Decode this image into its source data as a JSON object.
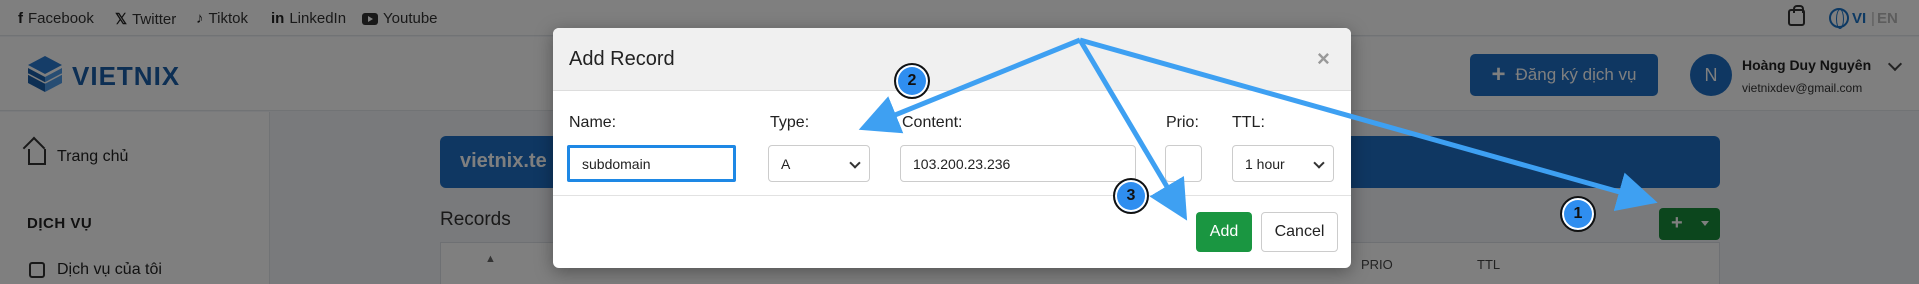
{
  "topbar": {
    "social": [
      {
        "icon": "facebook-icon",
        "glyph": "f",
        "label": "Facebook"
      },
      {
        "icon": "twitter-icon",
        "glyph": "𝕏",
        "label": "Twitter"
      },
      {
        "icon": "tiktok-icon",
        "glyph": "♪",
        "label": "Tiktok"
      },
      {
        "icon": "linkedin-icon",
        "glyph": "in",
        "label": "LinkedIn"
      },
      {
        "icon": "youtube-icon",
        "glyph": "",
        "label": "Youtube"
      }
    ],
    "lang_vi": "VI",
    "lang_sep": "|",
    "lang_en": "EN"
  },
  "header": {
    "logo_text": "VIETNIX",
    "signup_label": "Đăng ký dịch vụ",
    "signup_plus": "+",
    "user_initial": "N",
    "user_name": "Hoàng Duy Nguyên",
    "user_email": "vietnixdev@gmail.com"
  },
  "sidebar": {
    "home": "Trang chủ",
    "section": "DỊCH VỤ",
    "my_service": "Dịch vụ của tôi"
  },
  "main": {
    "domain": "vietnix.te",
    "records_title": "Records",
    "add_plus": "+",
    "table": {
      "sort_glyph": "▲",
      "prio": "PRIO",
      "ttl": "TTL"
    }
  },
  "modal": {
    "title": "Add Record",
    "close": "×",
    "name_label": "Name:",
    "name_value": "subdomain",
    "type_label": "Type:",
    "type_value": "A",
    "content_label": "Content:",
    "content_value": "103.200.23.236",
    "prio_label": "Prio:",
    "prio_value": "",
    "ttl_label": "TTL:",
    "ttl_value": "1 hour",
    "add_label": "Add",
    "cancel_label": "Cancel"
  },
  "annotations": {
    "color": "#3ea0f2",
    "badges": [
      "1",
      "2",
      "3"
    ]
  }
}
